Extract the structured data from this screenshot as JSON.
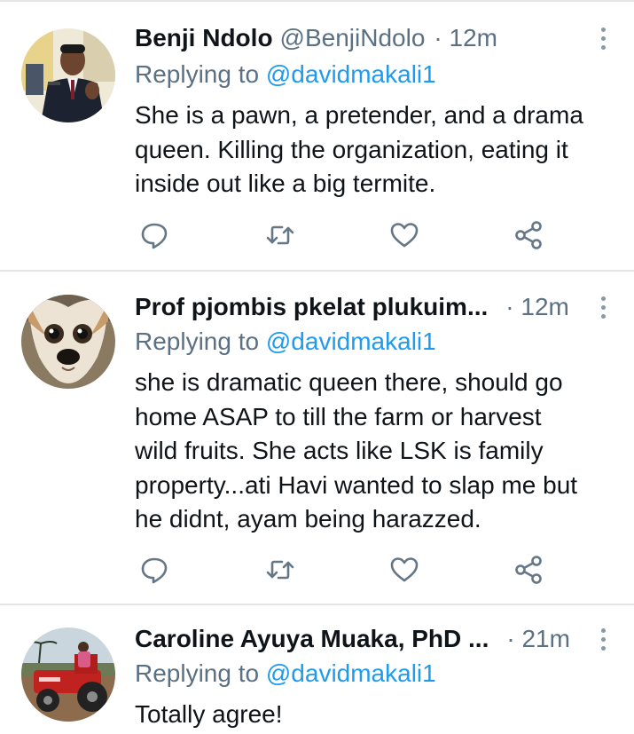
{
  "tweets": [
    {
      "name": "Benji Ndolo",
      "handle": "@BenjiNdolo",
      "separator": "·",
      "time": "12m",
      "replying_prefix": "Replying to",
      "replying_to": "@davidmakali1",
      "text_lines": [
        "She is a pawn, a pretender, and a drama",
        "queen. Killing the organization, eating it",
        "inside out like a big termite."
      ],
      "avatar": "portrait-speaker-podium"
    },
    {
      "name": "Prof pjombis pkelat plukuim...",
      "handle": "",
      "separator": "·",
      "time": "12m",
      "replying_prefix": "Replying to",
      "replying_to": "@davidmakali1",
      "text_lines": [
        "she is dramatic queen there, should go",
        "home ASAP to till the farm or harvest",
        "wild fruits. She acts like LSK is family",
        "property...ati Havi wanted to slap me but",
        "he didnt, ayam being harazzed."
      ],
      "avatar": "dog-face"
    },
    {
      "name": "Caroline Ayuya Muaka, PhD ...",
      "handle": "",
      "separator": "·",
      "time": "21m",
      "replying_prefix": "Replying to",
      "replying_to": "@davidmakali1",
      "text_lines": [
        "Totally agree!"
      ],
      "avatar": "person-on-red-tractor"
    }
  ],
  "action_icons": [
    "reply-icon",
    "retweet-icon",
    "like-icon",
    "share-icon"
  ],
  "more_icon": "more-vertical-icon",
  "colors": {
    "text": "#0f1419",
    "secondary": "#5b7083",
    "link": "#1d9bf0",
    "icon": "#657786",
    "divider": "#e3e6e9"
  }
}
